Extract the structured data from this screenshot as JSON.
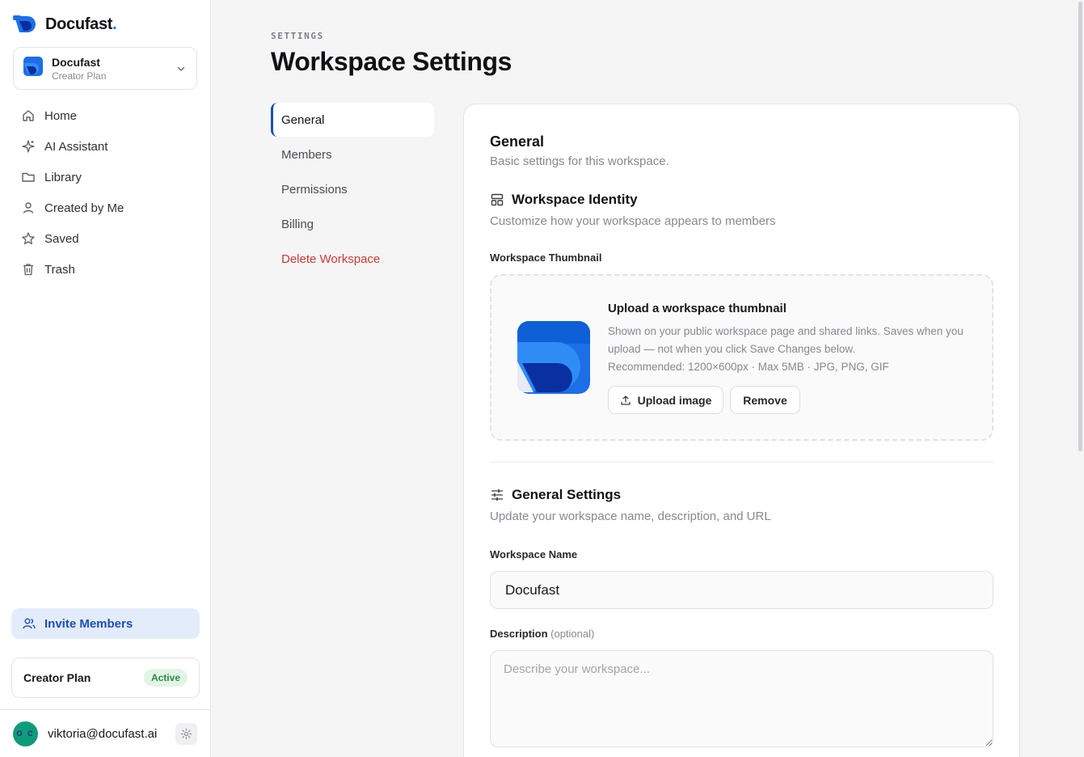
{
  "brand": {
    "name": "Docufast",
    "dot": "."
  },
  "workspace_switcher": {
    "name": "Docufast",
    "plan": "Creator Plan"
  },
  "nav": {
    "items": [
      {
        "label": "Home",
        "icon": "home-icon"
      },
      {
        "label": "AI Assistant",
        "icon": "sparkle-icon"
      },
      {
        "label": "Library",
        "icon": "folder-icon"
      },
      {
        "label": "Created by Me",
        "icon": "user-icon"
      },
      {
        "label": "Saved",
        "icon": "star-icon"
      },
      {
        "label": "Trash",
        "icon": "trash-icon"
      }
    ]
  },
  "invite": {
    "label": "Invite Members"
  },
  "plan_card": {
    "name": "Creator Plan",
    "status": "Active"
  },
  "user": {
    "email": "viktoria@docufast.ai",
    "initials": "O C"
  },
  "header": {
    "eyebrow": "SETTINGS",
    "title": "Workspace Settings"
  },
  "subnav": {
    "items": [
      {
        "label": "General"
      },
      {
        "label": "Members"
      },
      {
        "label": "Permissions"
      },
      {
        "label": "Billing"
      },
      {
        "label": "Delete Workspace"
      }
    ]
  },
  "general": {
    "title": "General",
    "subtitle": "Basic settings for this workspace.",
    "identity": {
      "title": "Workspace Identity",
      "subtitle": "Customize how your workspace appears to members",
      "thumbnail_label": "Workspace Thumbnail",
      "upload_title": "Upload a workspace thumbnail",
      "upload_desc_1": "Shown on your public workspace page and shared links. Saves when you upload — not when you click Save Changes below.",
      "upload_desc_2": "Recommended: 1200×600px · Max 5MB · JPG, PNG, GIF",
      "upload_button": "Upload image",
      "remove_button": "Remove"
    },
    "settings": {
      "title": "General Settings",
      "subtitle": "Update your workspace name, description, and URL",
      "name_label": "Workspace Name",
      "name_value": "Docufast",
      "desc_label": "Description",
      "desc_optional": "(optional)",
      "desc_placeholder": "Describe your workspace..."
    }
  },
  "colors": {
    "accent": "#1b4fb4",
    "brand_blue": "#1c6fe6",
    "danger": "#c93b34",
    "active_badge": "#2a8a45"
  }
}
